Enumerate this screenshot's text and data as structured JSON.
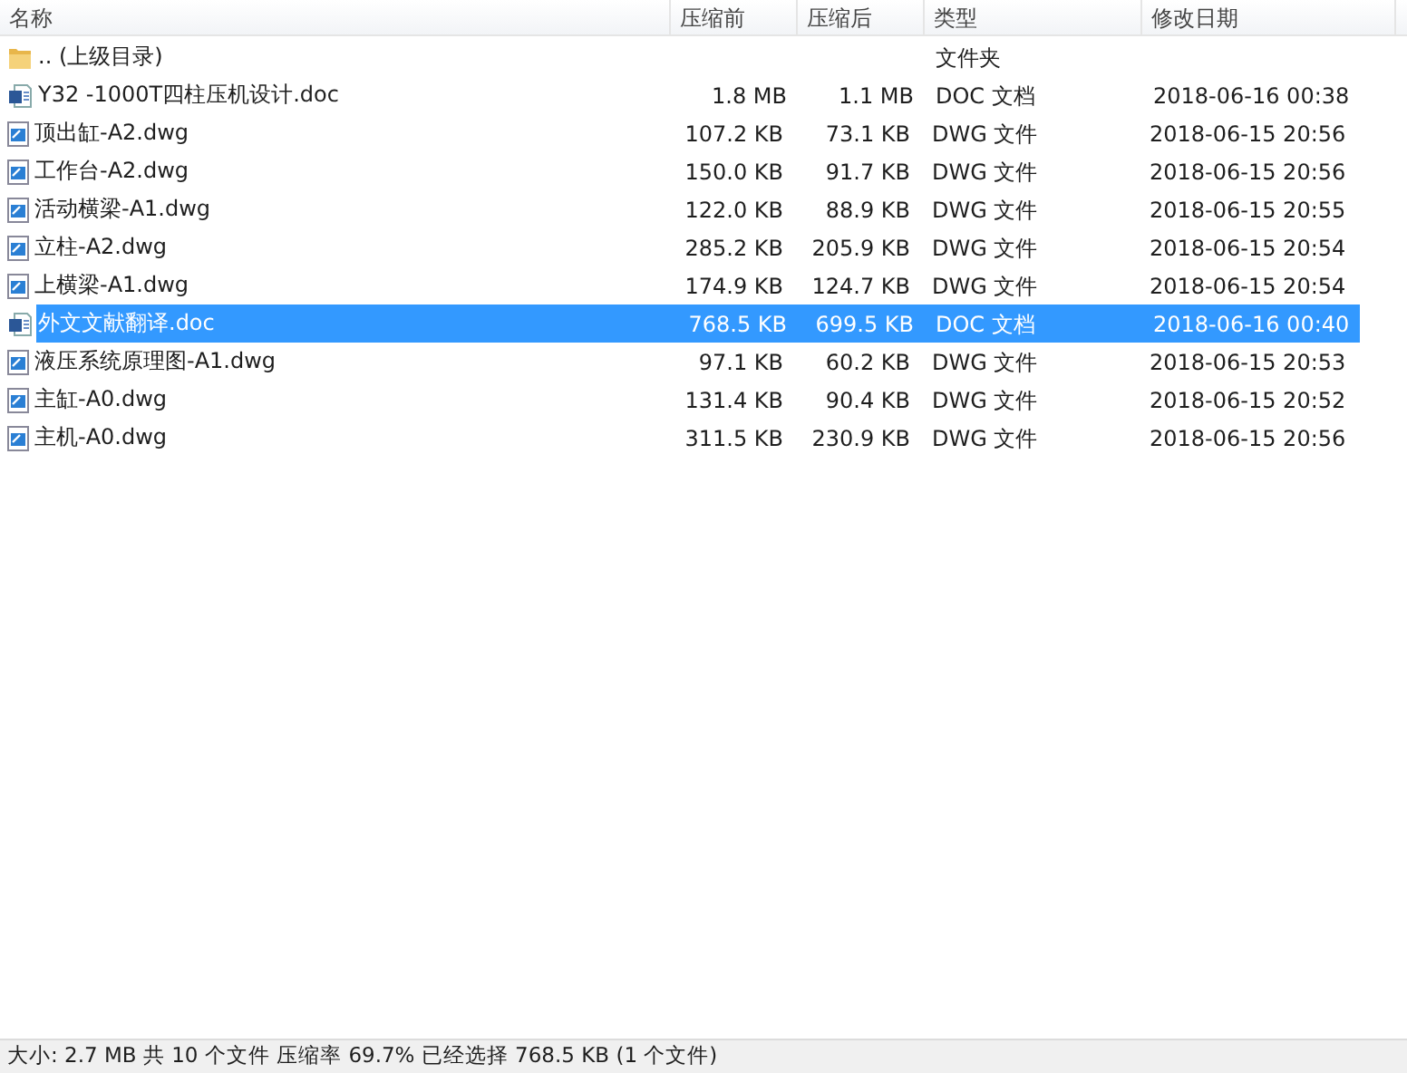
{
  "columns": [
    "名称",
    "压缩前",
    "压缩后",
    "类型",
    "修改日期"
  ],
  "rows": [
    {
      "kind": "folder",
      "name": ".. (上级目录)",
      "before": "",
      "after": "",
      "type": "文件夹",
      "date": "",
      "selected": false
    },
    {
      "kind": "doc",
      "name": "Y32 -1000T四柱压机设计.doc",
      "before": "1.8 MB",
      "after": "1.1 MB",
      "type": "DOC 文档",
      "date": "2018-06-16 00:38",
      "selected": false
    },
    {
      "kind": "dwg",
      "name": "顶出缸-A2.dwg",
      "before": "107.2 KB",
      "after": "73.1 KB",
      "type": "DWG 文件",
      "date": "2018-06-15 20:56",
      "selected": false
    },
    {
      "kind": "dwg",
      "name": "工作台-A2.dwg",
      "before": "150.0 KB",
      "after": "91.7 KB",
      "type": "DWG 文件",
      "date": "2018-06-15 20:56",
      "selected": false
    },
    {
      "kind": "dwg",
      "name": "活动横梁-A1.dwg",
      "before": "122.0 KB",
      "after": "88.9 KB",
      "type": "DWG 文件",
      "date": "2018-06-15 20:55",
      "selected": false
    },
    {
      "kind": "dwg",
      "name": "立柱-A2.dwg",
      "before": "285.2 KB",
      "after": "205.9 KB",
      "type": "DWG 文件",
      "date": "2018-06-15 20:54",
      "selected": false
    },
    {
      "kind": "dwg",
      "name": "上横梁-A1.dwg",
      "before": "174.9 KB",
      "after": "124.7 KB",
      "type": "DWG 文件",
      "date": "2018-06-15 20:54",
      "selected": false
    },
    {
      "kind": "doc",
      "name": "外文文献翻译.doc",
      "before": "768.5 KB",
      "after": "699.5 KB",
      "type": "DOC 文档",
      "date": "2018-06-16 00:40",
      "selected": true
    },
    {
      "kind": "dwg",
      "name": "液压系统原理图-A1.dwg",
      "before": "97.1 KB",
      "after": "60.2 KB",
      "type": "DWG 文件",
      "date": "2018-06-15 20:53",
      "selected": false
    },
    {
      "kind": "dwg",
      "name": "主缸-A0.dwg",
      "before": "131.4 KB",
      "after": "90.4 KB",
      "type": "DWG 文件",
      "date": "2018-06-15 20:52",
      "selected": false
    },
    {
      "kind": "dwg",
      "name": "主机-A0.dwg",
      "before": "311.5 KB",
      "after": "230.9 KB",
      "type": "DWG 文件",
      "date": "2018-06-15 20:56",
      "selected": false
    }
  ],
  "status_bar": "大小: 2.7 MB 共 10 个文件 压缩率 69.7% 已经选择 768.5 KB (1 个文件)"
}
